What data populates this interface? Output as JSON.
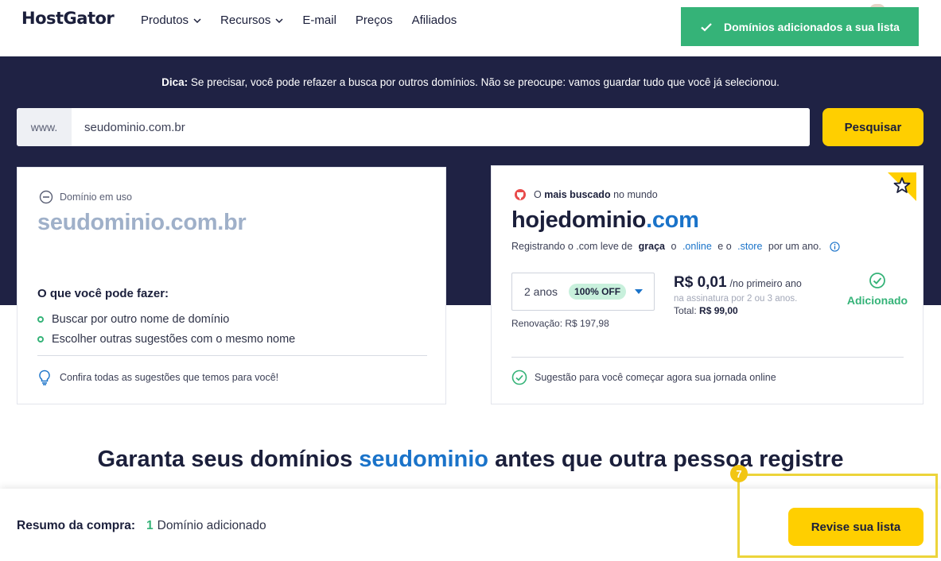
{
  "header": {
    "logo": "HostGator",
    "nav": [
      {
        "label": "Produtos",
        "has_dropdown": true
      },
      {
        "label": "Recursos",
        "has_dropdown": true
      },
      {
        "label": "E-mail",
        "has_dropdown": false
      },
      {
        "label": "Preços",
        "has_dropdown": false
      },
      {
        "label": "Afiliados",
        "has_dropdown": false
      }
    ]
  },
  "toast": {
    "text": "Domínios adicionados a sua lista",
    "color": "#35b378",
    "icon": "check-icon"
  },
  "tip": {
    "label": "Dica:",
    "text": " Se precisar, você pode refazer a busca por outros domínios. Não se preocupe: vamos guardar tudo que você já selecionou."
  },
  "search": {
    "prefix": "www.",
    "value": "seudominio.com.br",
    "button": "Pesquisar"
  },
  "unavailable": {
    "status": "Domínio em uso",
    "domain": "seudominio.com.br",
    "options_title": "O que você pode fazer:",
    "options": [
      "Buscar por outro nome de domínio",
      "Escolher outras sugestões com o mesmo nome"
    ],
    "footer": "Confira todas as sugestões que temos para você!"
  },
  "suggestion": {
    "popular_prefix": "O",
    "popular_bold": "mais buscado",
    "popular_suffix": "no mundo",
    "domain_name": "hojedominio",
    "domain_tld": ".com",
    "promo": {
      "p1": "Registrando o .com leve de",
      "p2": "graça",
      "p3": "o",
      "p4": ".online",
      "p5": "e o",
      "p6": ".store",
      "p7": "por um ano."
    },
    "period": "2 anos",
    "discount": "100% OFF",
    "renewal": "Renovação: R$ 197,98",
    "price": "R$ 0,01",
    "price_period": "/no primeiro ano",
    "price_note": "na assinatura por 2 ou 3 anos.",
    "total_label": "Total:",
    "total_value": "R$ 99,00",
    "added_label": "Adicionado",
    "footer": "Sugestão para você começar agora sua jornada online"
  },
  "headline": {
    "before": "Garanta seus domínios ",
    "keyword": "seudominio",
    "after": " antes que outra pessoa registre"
  },
  "bottom_bar": {
    "summary_label": "Resumo da compra:",
    "count": "1",
    "count_text": "Domínio adicionado",
    "review_button": "Revise sua lista",
    "step_number": "7"
  },
  "colors": {
    "brand_dark": "#1f2244",
    "accent_yellow": "#ffcf00",
    "success_green": "#35b378",
    "link_blue": "#1a73c9"
  }
}
